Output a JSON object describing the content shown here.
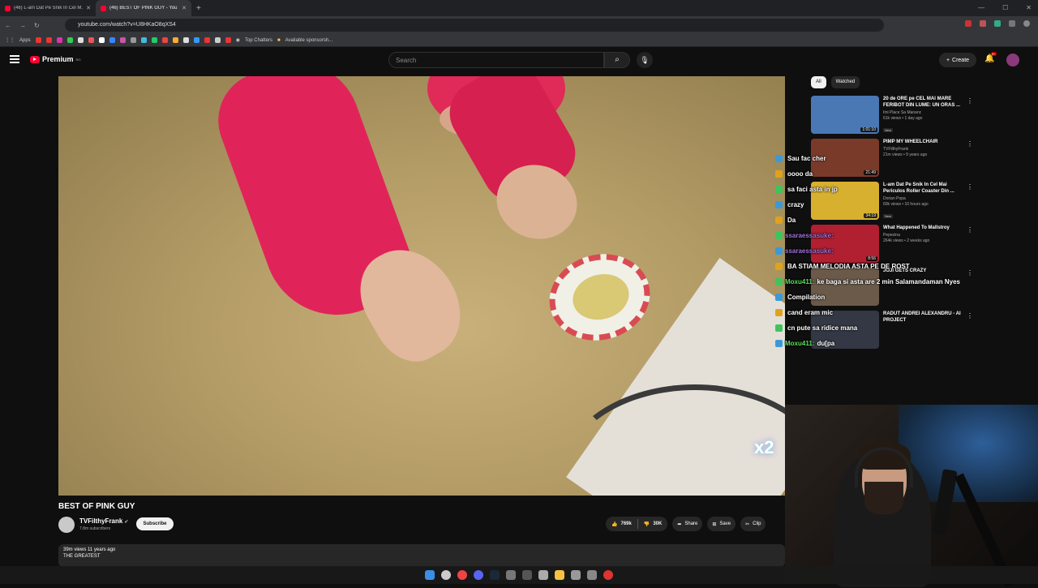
{
  "browser": {
    "tabs": [
      {
        "title": "(46) L-am Dat Pe Snik In Cel M...",
        "active": false
      },
      {
        "title": "(46) BEST OF PINK GUY - YouTu...",
        "active": true
      }
    ],
    "url": "youtube.com/watch?v=U8HKaO8qXS4",
    "bookmarks": {
      "apps_label": "Apps",
      "items": [
        "Top Chatters",
        "Available sponsorsh..."
      ]
    }
  },
  "masthead": {
    "logo_text": "Premium",
    "logo_sup": "RO",
    "search_placeholder": "Search",
    "create_label": "Create",
    "notif_count": "9+"
  },
  "video": {
    "title": "BEST OF PINK GUY",
    "overlay_badge": "x2",
    "channel": {
      "name": "TVFilthyFrank",
      "subscribers": "7.8m subscribers",
      "subscribe_label": "Subscribe"
    },
    "actions": {
      "likes": "769k",
      "dislikes": "30K",
      "share": "Share",
      "save": "Save",
      "clip": "Clip"
    },
    "description": {
      "meta": "39m views  11 years ago",
      "text": "THE GREATEST"
    }
  },
  "sidebar": {
    "chips": [
      {
        "label": "All",
        "active": true
      },
      {
        "label": "Watched",
        "active": false
      }
    ],
    "recommendations": [
      {
        "title": "20 de ORE pe CEL MAI MARE FERIBOT DIN LUME: UN ORAS ...",
        "channel": "Imi Place Sa Mananc",
        "meta": "61k views • 1 day ago",
        "badge": "New",
        "duration": "1:01:10",
        "thumb_color": "#4a78b5"
      },
      {
        "title": "PIMP MY WHEELCHAIR",
        "channel": "TVFilthyFrank",
        "meta": "21m views • 9 years ago",
        "badge": "",
        "duration": "21:49",
        "thumb_color": "#7a3a2a"
      },
      {
        "title": "L-am Dat Pe Snik In Cel Mai Periculos Roller Coaster Din ...",
        "channel": "Dorian Popa",
        "meta": "60k views • 10 hours ago",
        "badge": "New",
        "duration": "34:19",
        "thumb_color": "#d8b030"
      },
      {
        "title": "What Happened To Mallstroy",
        "channel": "Pepezina",
        "meta": "264k views • 2 weeks ago",
        "badge": "",
        "duration": "8:56",
        "thumb_color": "#b02030"
      },
      {
        "title": "JOJI GETS CRAZY",
        "channel": "",
        "meta": "",
        "badge": "",
        "duration": "",
        "thumb_color": "#6b5a4a"
      },
      {
        "title": "RADUT ANDREI ALEXANDRU - AI PROJECT",
        "channel": "",
        "meta": "",
        "badge": "",
        "duration": "",
        "thumb_color": "#333844"
      }
    ]
  },
  "chat_overlay": [
    {
      "user": "",
      "message": "Sau fac cher",
      "user_color": "#57e05a"
    },
    {
      "user": "",
      "message": "oooo da",
      "user_color": "#57e05a"
    },
    {
      "user": "",
      "message": "sa faci asta in jp",
      "user_color": "#57e05a"
    },
    {
      "user": "",
      "message": "crazy",
      "user_color": "#57e05a"
    },
    {
      "user": "",
      "message": "Da",
      "user_color": "#57e05a"
    },
    {
      "user": "ssaraessasuke:",
      "message": "",
      "user_color": "#a070d8"
    },
    {
      "user": "ssaraessasuke:",
      "message": "",
      "user_color": "#a070d8"
    },
    {
      "user": "",
      "message": "BA STIAM MELODIA ASTA PE DE ROST",
      "user_color": "#57e05a"
    },
    {
      "user": "Moxu411:",
      "message": "ke baga si asta are 2 min  Salamandaman Nyes",
      "user_color": "#57e05a"
    },
    {
      "user": "",
      "message": "Compilation",
      "user_color": "#57e05a"
    },
    {
      "user": "",
      "message": "cand eram mic",
      "user_color": "#57e05a"
    },
    {
      "user": "",
      "message": "cn pute sa ridice mana",
      "user_color": "#57e05a"
    },
    {
      "user": "Moxu411:",
      "message": "du[pa",
      "user_color": "#57e05a"
    }
  ]
}
